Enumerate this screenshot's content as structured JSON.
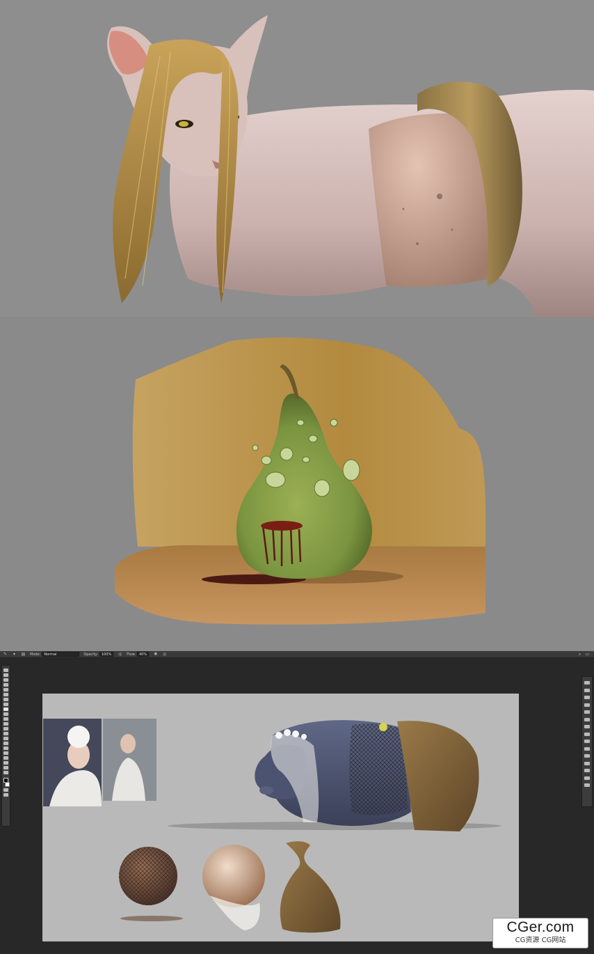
{
  "photoshop": {
    "options_bar": {
      "mode_label": "Mode:",
      "mode_value": "Normal",
      "opacity_label": "Opacity:",
      "opacity_value": "100%",
      "flow_label": "Flow:",
      "flow_value": "40%"
    }
  },
  "watermark": {
    "main": "CGer.com",
    "sub": "CG资源 CG网站"
  },
  "colors": {
    "ps_background": "#282828",
    "ps_canvas": "#b9b9b9",
    "panel_gray": "#8c8c8c"
  }
}
